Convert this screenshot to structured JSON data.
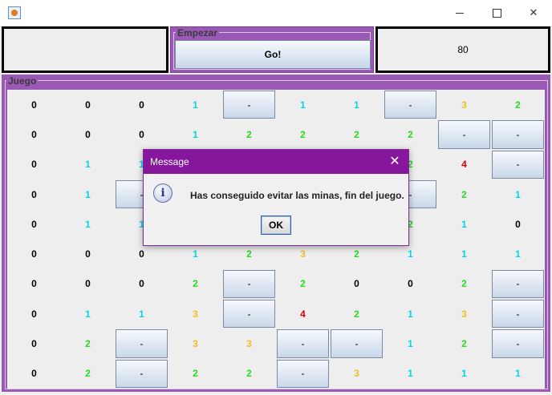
{
  "window": {
    "title": "",
    "buttons": {
      "minimize": "minimize-icon",
      "maximize": "maximize-icon",
      "close": "close-icon"
    }
  },
  "top": {
    "left_panel": "",
    "empezar": {
      "legend": "Empezar",
      "go_label": "Go!"
    },
    "counter": "80"
  },
  "juego": {
    "legend": "Juego",
    "grid": [
      [
        "0",
        "0",
        "0",
        "1",
        "-",
        "1",
        "1",
        "-",
        "3",
        "2"
      ],
      [
        "0",
        "0",
        "0",
        "1",
        "2",
        "2",
        "2",
        "2",
        "-",
        "-"
      ],
      [
        "0",
        "1",
        "1",
        "",
        "",
        "",
        "",
        "2",
        "4",
        "-"
      ],
      [
        "0",
        "1",
        "-",
        "",
        "",
        "",
        "",
        "-",
        "2",
        "1"
      ],
      [
        "0",
        "1",
        "1",
        "",
        "",
        "",
        "",
        "2",
        "1",
        "0"
      ],
      [
        "0",
        "0",
        "0",
        "1",
        "2",
        "3",
        "2",
        "1",
        "1",
        "1"
      ],
      [
        "0",
        "0",
        "0",
        "2",
        "-",
        "2",
        "0",
        "0",
        "2",
        "-"
      ],
      [
        "0",
        "1",
        "1",
        "3",
        "-",
        "4",
        "2",
        "1",
        "3",
        "-"
      ],
      [
        "0",
        "2",
        "-",
        "3",
        "3",
        "-",
        "-",
        "1",
        "2",
        "-"
      ],
      [
        "0",
        "2",
        "-",
        "2",
        "2",
        "-",
        "3",
        "1",
        "1",
        "1"
      ]
    ],
    "covered_marker": "-",
    "number_colors": {
      "0": "#000000",
      "1": "#00d8e8",
      "2": "#22dd22",
      "3": "#f0c020",
      "4": "#dd0000"
    }
  },
  "dialog": {
    "title": "Message",
    "icon": "info-icon",
    "message": "Has conseguido evitar las minas, fin del juego.",
    "ok_label": "OK"
  }
}
